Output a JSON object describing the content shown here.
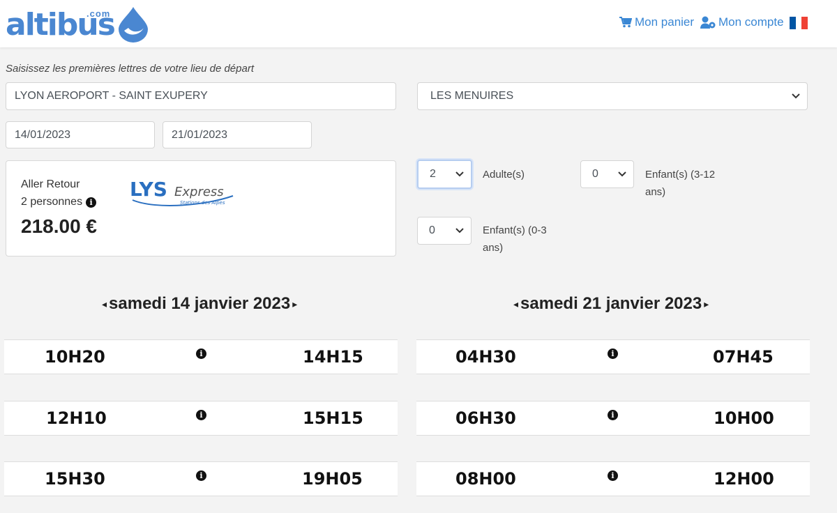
{
  "header": {
    "logo_text": "altibus",
    "logo_suffix": ".com",
    "cart_label": "Mon panier",
    "account_label": "Mon compte",
    "flag_colors": [
      "#0055a4",
      "#ffffff",
      "#ef4135"
    ]
  },
  "search": {
    "hint": "Saisissez les premières lettres de votre lieu de départ",
    "departure_value": "LYON AEROPORT - SAINT EXUPERY",
    "destination_value": "LES MENUIRES",
    "date_outbound": "14/01/2023",
    "date_return": "21/01/2023"
  },
  "summary": {
    "trip_type": "Aller Retour",
    "persons": "2 personnes",
    "price": "218.00 €",
    "logo_main": "LYS",
    "logo_script": "Express",
    "logo_sub": "Stations des Alpes"
  },
  "passengers": {
    "adults_value": "2",
    "adults_label": "Adulte(s)",
    "children_value": "0",
    "children_label_1": "Enfant(s) (3-12",
    "children_label_2": "ans)",
    "infants_value": "0",
    "infants_label_1": "Enfant(s) (0-3",
    "infants_label_2": "ans)"
  },
  "outbound": {
    "date_label": "samedi 14 janvier 2023",
    "rows": [
      {
        "dep": "10H20",
        "arr": "14H15"
      },
      {
        "dep": "12H10",
        "arr": "15H15"
      },
      {
        "dep": "15H30",
        "arr": "19H05"
      }
    ]
  },
  "return": {
    "date_label": "samedi 21 janvier 2023",
    "rows": [
      {
        "dep": "04H30",
        "arr": "07H45"
      },
      {
        "dep": "06H30",
        "arr": "10H00"
      },
      {
        "dep": "08H00",
        "arr": "12H00"
      }
    ]
  },
  "colors": {
    "brand_blue": "#4a87d1",
    "link_blue": "#3a87d4"
  }
}
